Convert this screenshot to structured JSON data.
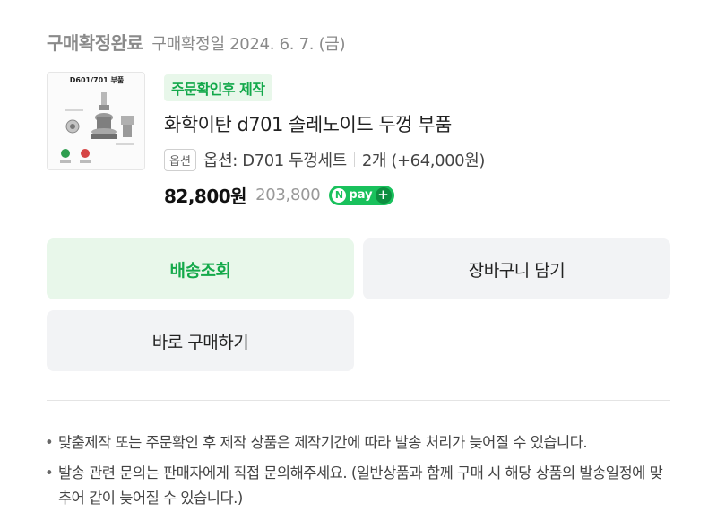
{
  "order": {
    "status": "구매확정완료",
    "confirm_date": "구매확정일 2024. 6. 7. (금)"
  },
  "product": {
    "thumbnail_caption": "D601/701 부품",
    "badge": "주문확인후 제작",
    "name": "화학이탄 d701 솔레노이드 두껑 부품",
    "option_tag": "옵션",
    "option_text": "옵션: D701 두껑세트",
    "quantity_text": "2개 (+64,000원)",
    "price_current": "82,800원",
    "price_original": "203,800",
    "pay_badge": "pay"
  },
  "buttons": {
    "delivery": "배송조회",
    "cart": "장바구니 담기",
    "buy_now": "바로 구매하기"
  },
  "notices": [
    "맞춤제작 또는 주문확인 후 제작 상품은 제작기간에 따라 발송 처리가 늦어질 수 있습니다.",
    "발송 관련 문의는 판매자에게 직접 문의해주세요. (일반상품과 함께 구매 시 해당 상품의 발송일정에 맞추어 같이 늦어질 수 있습니다.)"
  ],
  "colors": {
    "accent_green": "#14a94a",
    "badge_bg": "#e8f7ea",
    "npay_green": "#19c15c",
    "button_gray": "#f2f3f5"
  }
}
